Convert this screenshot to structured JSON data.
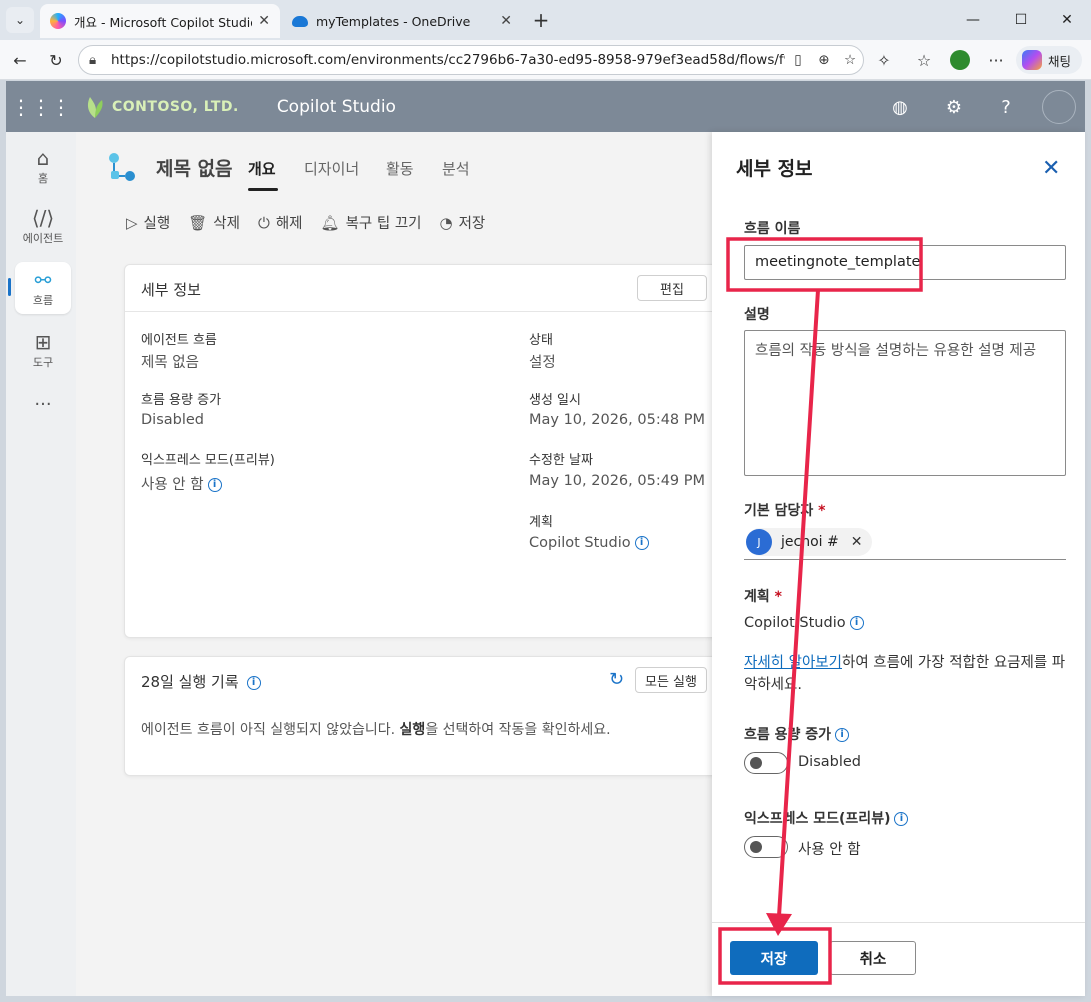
{
  "browser": {
    "tabs": [
      {
        "title": "개요 - Microsoft Copilot Studio",
        "active": true
      },
      {
        "title": "myTemplates - OneDrive",
        "active": false
      }
    ],
    "url": "https://copilotstudio.microsoft.com/environments/cc2796b6-7a30-ed95-8958-979ef3ead58d/flows/f9b3c...",
    "chat_label": "채팅"
  },
  "app": {
    "brand": "CONTOSO, LTD.",
    "name": "Copilot Studio"
  },
  "rail": [
    {
      "label": "홈",
      "icon": "home-icon"
    },
    {
      "label": "에이전트",
      "icon": "code-icon"
    },
    {
      "label": "흐름",
      "icon": "flow-icon"
    },
    {
      "label": "도구",
      "icon": "tools-icon"
    }
  ],
  "page": {
    "title": "제목 없음",
    "tabs": [
      "개요",
      "디자이너",
      "활동",
      "분석"
    ],
    "commands": [
      "실행",
      "삭제",
      "해제",
      "복구 팁 끄기",
      "저장"
    ]
  },
  "details_card": {
    "title": "세부 정보",
    "edit": "편집",
    "left": [
      {
        "label": "에이전트 흐름",
        "value": "제목 없음"
      },
      {
        "label": "흐름 용량 증가",
        "value": "Disabled"
      },
      {
        "label": "익스프레스 모드(프리뷰)",
        "value": "사용 안 함"
      }
    ],
    "right": [
      {
        "label": "상태",
        "value": "설정"
      },
      {
        "label": "생성 일시",
        "value": "May 10, 2026, 05:48 PM"
      },
      {
        "label": "수정한 날짜",
        "value": "May 10, 2026, 05:49 PM"
      },
      {
        "label": "계획",
        "value": "Copilot Studio"
      }
    ]
  },
  "runs_card": {
    "title": "28일 실행 기록",
    "all_runs": "모든 실행",
    "msg_pre": "에이전트 흐름이 아직 실행되지 않았습니다. ",
    "msg_bold": "실행",
    "msg_post": "을 선택하여 작동을 확인하세요."
  },
  "panel": {
    "title": "세부 정보",
    "flow_name_label": "흐름 이름",
    "flow_name_value": "meetingnote_template",
    "desc_label": "설명",
    "desc_placeholder": "흐름의 작동 방식을 설명하는 유용한 설명 제공",
    "owner_label": "기본 담당자",
    "owner_initial": "J",
    "owner_name": "jechoi #",
    "plan_label": "계획",
    "plan_value": "Copilot Studio",
    "learn_link": "자세히 알아보기",
    "learn_rest": "하여 흐름에 가장 적합한 요금제를 파악하세요.",
    "capacity_label": "흐름 용량 증가",
    "capacity_value": "Disabled",
    "express_label": "익스프레스 모드(프리뷰)",
    "express_value": "사용 안 함",
    "save": "저장",
    "cancel": "취소"
  },
  "colors": {
    "accent": "#0f6cbd",
    "header": "#7d8997",
    "annotation": "#e8254a"
  }
}
